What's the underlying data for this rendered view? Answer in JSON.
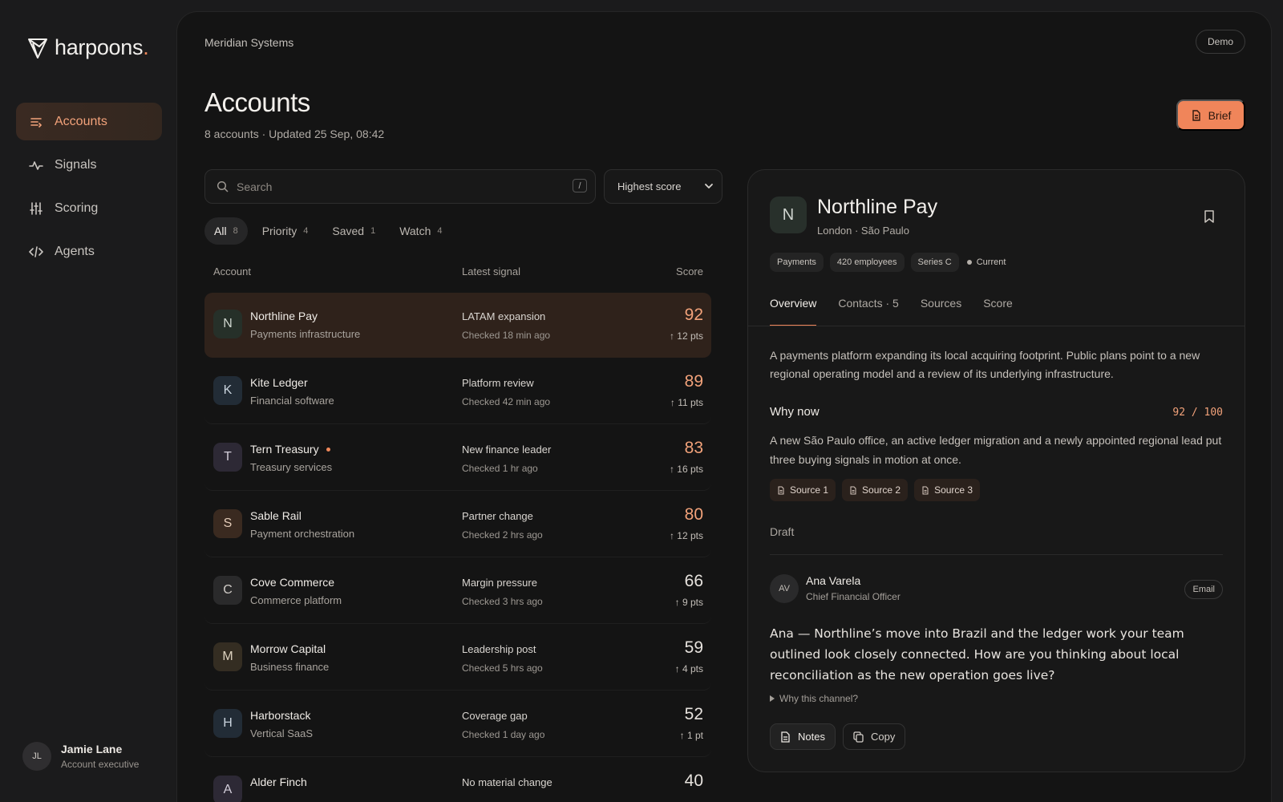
{
  "brand": {
    "name": "harpoons",
    "dot": "."
  },
  "nav": [
    {
      "label": "Accounts",
      "icon": "list-icon",
      "active": true
    },
    {
      "label": "Signals",
      "icon": "pulse-icon",
      "active": false
    },
    {
      "label": "Scoring",
      "icon": "sliders-icon",
      "active": false
    },
    {
      "label": "Agents",
      "icon": "code-icon",
      "active": false
    }
  ],
  "user": {
    "initials": "JL",
    "name": "Jamie Lane",
    "role": "Account executive"
  },
  "header": {
    "org": "Meridian Systems",
    "demo_label": "Demo",
    "title": "Accounts",
    "subtitle": "8 accounts · Updated 25 Sep, 08:42",
    "brief_label": "Brief"
  },
  "search": {
    "placeholder": "Search",
    "shortcut": "/"
  },
  "sort": {
    "selected": "Highest score"
  },
  "filters": [
    {
      "label": "All",
      "count": "8",
      "active": true
    },
    {
      "label": "Priority",
      "count": "4",
      "active": false
    },
    {
      "label": "Saved",
      "count": "1",
      "active": false
    },
    {
      "label": "Watch",
      "count": "4",
      "active": false
    }
  ],
  "table": {
    "headers": {
      "account": "Account",
      "signal": "Latest signal",
      "score": "Score"
    },
    "rows": [
      {
        "initial": "N",
        "name": "Northline Pay",
        "type": "Payments infrastructure",
        "signal": "LATAM expansion",
        "checked": "Checked 18 min ago",
        "score": "92",
        "pts": "↑ 12 pts",
        "avatar_bg": "#263029",
        "avatar_fg": "#cfd6cf",
        "hot": true,
        "flag": false,
        "selected": true
      },
      {
        "initial": "K",
        "name": "Kite Ledger",
        "type": "Financial software",
        "signal": "Platform review",
        "checked": "Checked 42 min ago",
        "score": "89",
        "pts": "↑ 11 pts",
        "avatar_bg": "#222c36",
        "avatar_fg": "#c9d3dd",
        "hot": true,
        "flag": false,
        "selected": false
      },
      {
        "initial": "T",
        "name": "Tern Treasury",
        "type": "Treasury services",
        "signal": "New finance leader",
        "checked": "Checked 1 hr ago",
        "score": "83",
        "pts": "↑ 16 pts",
        "avatar_bg": "#2d2935",
        "avatar_fg": "#d2cdd9",
        "hot": true,
        "flag": true,
        "selected": false
      },
      {
        "initial": "S",
        "name": "Sable Rail",
        "type": "Payment orchestration",
        "signal": "Partner change",
        "checked": "Checked 2 hrs ago",
        "score": "80",
        "pts": "↑ 12 pts",
        "avatar_bg": "#3a2a20",
        "avatar_fg": "#e3cbb8",
        "hot": true,
        "flag": false,
        "selected": false
      },
      {
        "initial": "C",
        "name": "Cove Commerce",
        "type": "Commerce platform",
        "signal": "Margin pressure",
        "checked": "Checked 3 hrs ago",
        "score": "66",
        "pts": "↑ 9 pts",
        "avatar_bg": "#2a2a2b",
        "avatar_fg": "#d0ccc7",
        "hot": false,
        "flag": false,
        "selected": false
      },
      {
        "initial": "M",
        "name": "Morrow Capital",
        "type": "Business finance",
        "signal": "Leadership post",
        "checked": "Checked 5 hrs ago",
        "score": "59",
        "pts": "↑ 4 pts",
        "avatar_bg": "#342d22",
        "avatar_fg": "#ddd2bf",
        "hot": false,
        "flag": false,
        "selected": false
      },
      {
        "initial": "H",
        "name": "Harborstack",
        "type": "Vertical SaaS",
        "signal": "Coverage gap",
        "checked": "Checked 1 day ago",
        "score": "52",
        "pts": "↑ 1 pt",
        "avatar_bg": "#222c36",
        "avatar_fg": "#c9d3dd",
        "hot": false,
        "flag": false,
        "selected": false
      },
      {
        "initial": "A",
        "name": "Alder Finch",
        "type": "",
        "signal": "No material change",
        "checked": "",
        "score": "40",
        "pts": "",
        "avatar_bg": "#2d2935",
        "avatar_fg": "#d2cdd9",
        "hot": false,
        "flag": false,
        "selected": false
      }
    ]
  },
  "detail": {
    "initial": "N",
    "name": "Northline Pay",
    "location": "London · São Paulo",
    "tags": [
      "Payments",
      "420 employees",
      "Series C"
    ],
    "status": "Current",
    "tabs": [
      {
        "label": "Overview",
        "active": true
      },
      {
        "label": "Contacts · 5",
        "active": false
      },
      {
        "label": "Sources",
        "active": false
      },
      {
        "label": "Score",
        "active": false
      }
    ],
    "overview": "A payments platform expanding its local acquiring footprint. Public plans point to a new regional operating model and a review of its underlying infrastructure.",
    "why_now_title": "Why now",
    "why_now_score": "92 / 100",
    "why_now_text": "A new São Paulo office, an active ledger migration and a newly appointed regional lead put three buying signals in motion at once.",
    "sources": [
      "Source 1",
      "Source 2",
      "Source 3"
    ],
    "draft_label": "Draft",
    "contact": {
      "initials": "AV",
      "name": "Ana Varela",
      "role": "Chief Financial Officer",
      "channel": "Email"
    },
    "message": "Ana — Northline’s move into Brazil and the ledger work your team outlined look closely connected. How are you thinking about local reconciliation as the new operation goes live?",
    "why_channel": "Why this channel?",
    "actions": {
      "notes": "Notes",
      "copy": "Copy"
    }
  },
  "colors": {
    "accent": "#f0855a",
    "accent_text": "#f2a27a",
    "background": "#1b1b1c",
    "panel": "#141414"
  }
}
